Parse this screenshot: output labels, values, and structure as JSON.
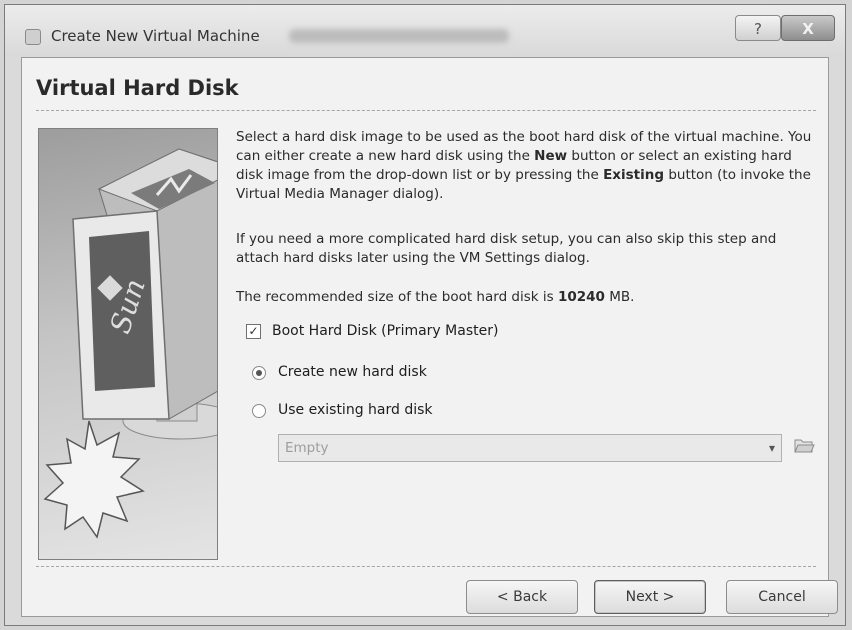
{
  "window": {
    "title": "Create New Virtual Machine",
    "help_label": "?",
    "close_label": "X"
  },
  "page": {
    "title": "Virtual Hard Disk"
  },
  "description": {
    "p1_a": "Select a hard disk image to be used as the boot hard disk of the virtual machine. You can either create a new hard disk using the ",
    "p1_new": "New",
    "p1_b": " button or select an existing hard disk image from the drop-down list or by pressing the ",
    "p1_existing": "Existing",
    "p1_c": " button (to invoke the Virtual Media Manager dialog).",
    "p2": "If you need a more complicated hard disk setup, you can also skip this step and attach hard disks later using the VM Settings dialog.",
    "p3_a": "The recommended size of the boot hard disk is ",
    "p3_size": "10240",
    "p3_b": " MB."
  },
  "options": {
    "boot_checkbox_label": "Boot Hard Disk (Primary Master)",
    "boot_checkbox_checked": true,
    "create_new_label": "Create new hard disk",
    "use_existing_label": "Use existing hard disk",
    "selected": "create_new",
    "disk_combo_value": "Empty"
  },
  "icons": {
    "window": "virtualbox-icon",
    "folder": "folder-open-icon",
    "dropdown": "chevron-down-icon"
  },
  "image": {
    "logo_text": "Sun"
  },
  "buttons": {
    "back": "< Back",
    "next": "Next >",
    "cancel": "Cancel"
  }
}
